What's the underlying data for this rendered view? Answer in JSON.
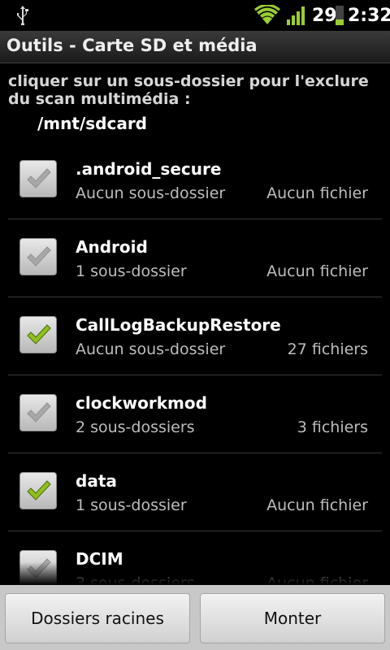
{
  "status": {
    "battery_level": "29",
    "time": "2:32",
    "icons": [
      "usb-icon",
      "wifi-icon",
      "signal-icon",
      "battery-icon"
    ]
  },
  "title": "Outils - Carte SD et média",
  "instructions": "cliquer sur un sous-dossier pour l'exclure du scan multimédia :",
  "path": "/mnt/sdcard",
  "folders": [
    {
      "name": ".android_secure",
      "subs_num": "",
      "subs_label": "Aucun sous-dossier",
      "files_num": "",
      "files_label": "Aucun fichier",
      "checked": false
    },
    {
      "name": "Android",
      "subs_num": "1",
      "subs_label": "sous-dossier",
      "files_num": "",
      "files_label": "Aucun fichier",
      "checked": false
    },
    {
      "name": "CallLogBackupRestore",
      "subs_num": "",
      "subs_label": "Aucun sous-dossier",
      "files_num": "27",
      "files_label": "fichiers",
      "checked": true
    },
    {
      "name": "clockworkmod",
      "subs_num": "2",
      "subs_label": "sous-dossiers",
      "files_num": "3",
      "files_label": "fichiers",
      "checked": false
    },
    {
      "name": "data",
      "subs_num": "1",
      "subs_label": "sous-dossier",
      "files_num": "",
      "files_label": "Aucun fichier",
      "checked": true
    },
    {
      "name": "DCIM",
      "subs_num": "3",
      "subs_label": "sous-dossiers",
      "files_num": "",
      "files_label": "Aucun fichier",
      "checked": false
    }
  ],
  "buttons": {
    "root_folders": "Dossiers racines",
    "mount": "Monter"
  },
  "colors": {
    "check_on": "#8fc01e",
    "check_off": "#a8a8a8"
  }
}
